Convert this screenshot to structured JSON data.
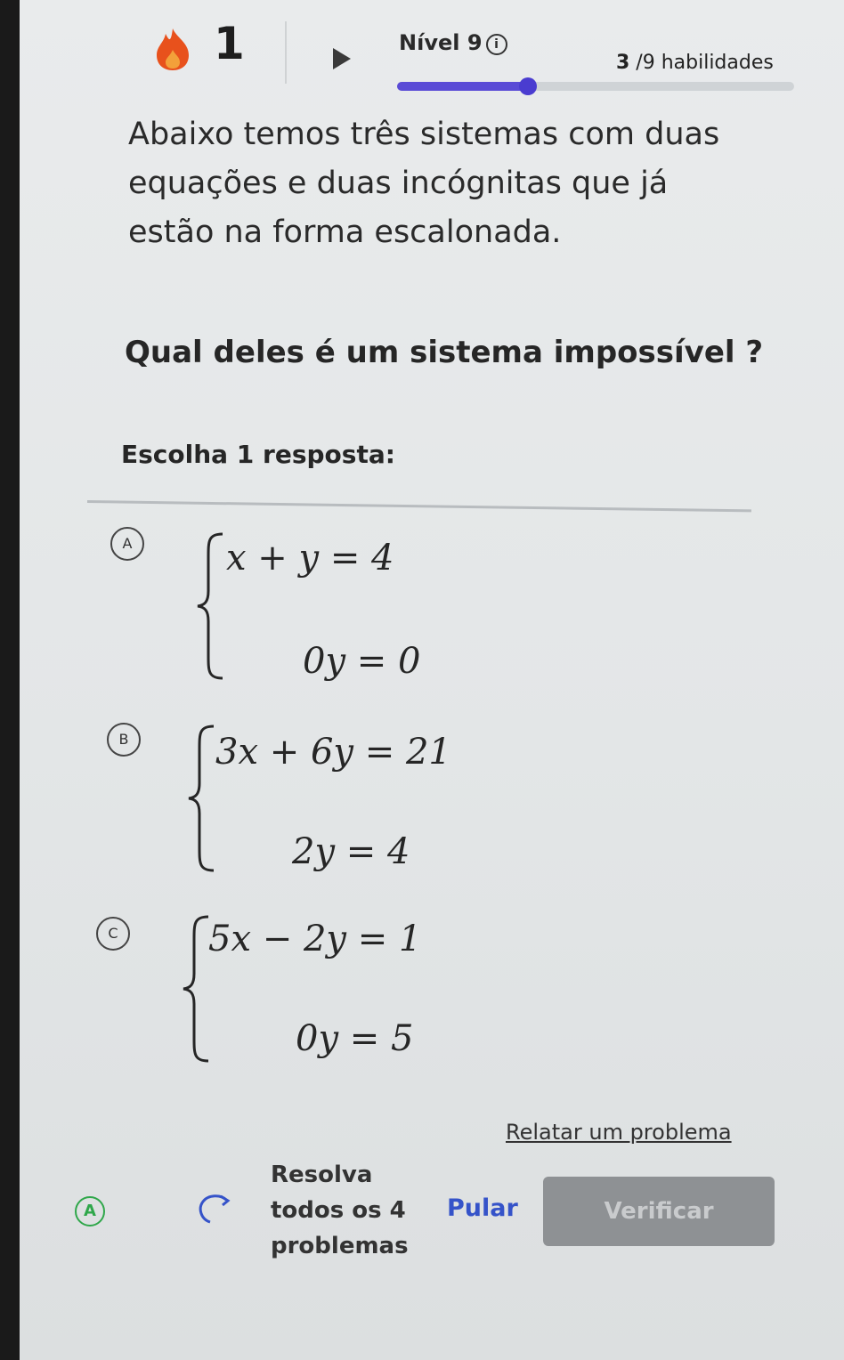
{
  "header": {
    "streak_count": "1",
    "level_label": "Nível 9",
    "info_glyph": "i",
    "skills_done": "3",
    "skills_text": " /9 habilidades",
    "progress_fraction": 0.33,
    "accent_color": "#5a4bd6",
    "flame_color": "#e8511c"
  },
  "content": {
    "prompt": "Abaixo temos três sistemas com duas equações e duas incógnitas que já estão na forma escalonada.",
    "question": "Qual deles é um sistema impossível ?",
    "choose_label": "Escolha 1 resposta:"
  },
  "choices": [
    {
      "letter": "A",
      "eq1": "x + y = 4",
      "eq2": "0y = 0"
    },
    {
      "letter": "B",
      "eq1": "3x + 6y = 21",
      "eq2": "2y = 4"
    },
    {
      "letter": "C",
      "eq1": "5x − 2y = 1",
      "eq2": "0y = 5"
    }
  ],
  "footer": {
    "report_link": "Relatar um problema",
    "hint_glyph": "A",
    "solve_line1": "Resolva",
    "solve_line2": "todos os 4",
    "solve_line3": "problemas",
    "skip_label": "Pular",
    "verify_label": "Verificar"
  }
}
